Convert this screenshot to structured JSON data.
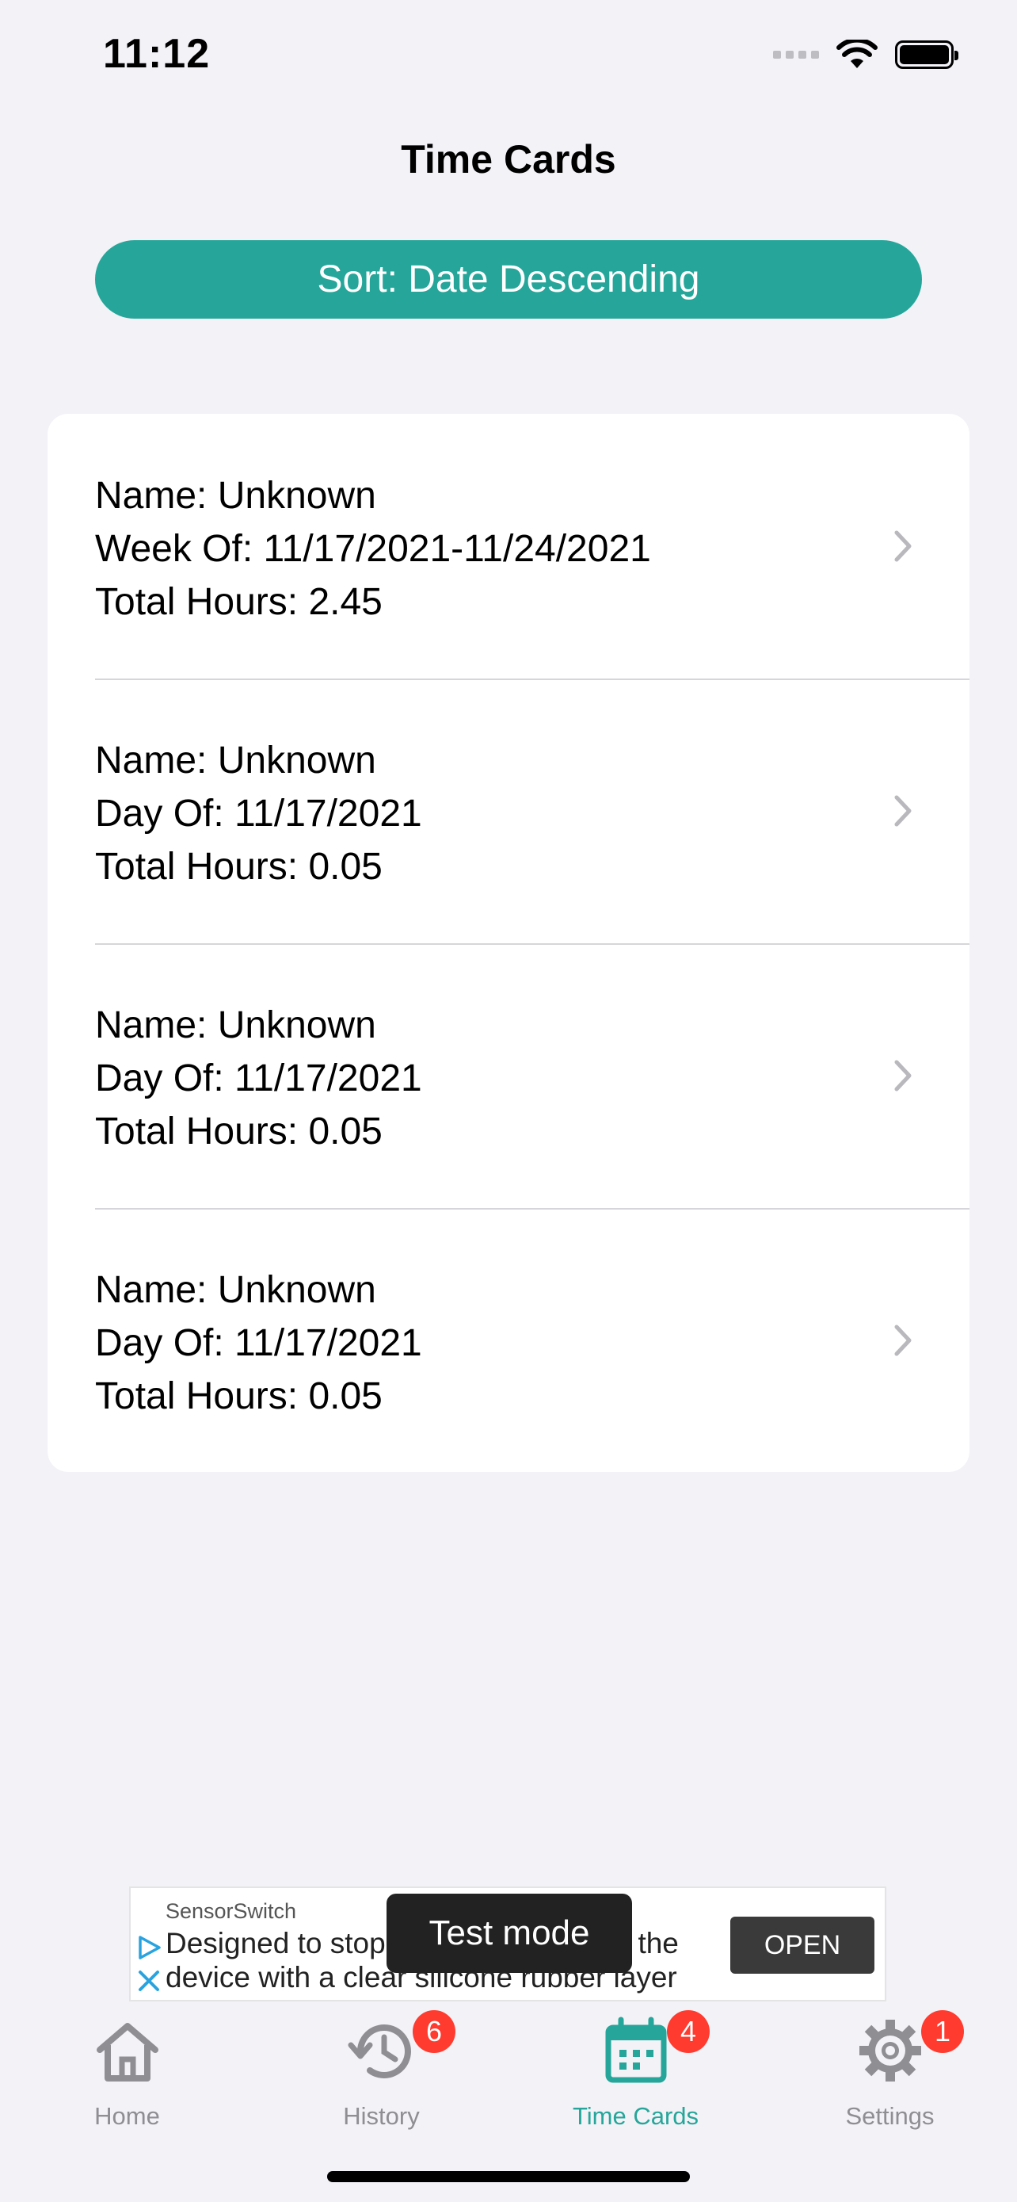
{
  "status_bar": {
    "time": "11:12"
  },
  "header": {
    "title": "Time Cards"
  },
  "sort_button": {
    "label": "Sort: Date Descending"
  },
  "time_cards": [
    {
      "name": "Name: Unknown",
      "period": "Week Of: 11/17/2021-11/24/2021",
      "hours": "Total Hours: 2.45"
    },
    {
      "name": "Name: Unknown",
      "period": "Day Of: 11/17/2021",
      "hours": "Total Hours: 0.05"
    },
    {
      "name": "Name: Unknown",
      "period": "Day Of: 11/17/2021",
      "hours": "Total Hours: 0.05"
    },
    {
      "name": "Name: Unknown",
      "period": "Day Of: 11/17/2021",
      "hours": "Total Hours: 0.05"
    }
  ],
  "ad": {
    "sponsor": "SensorSwitch",
    "line1": "Designed to stop dust from entering the",
    "line2": "device with a clear silicone rubber layer",
    "open_label": "OPEN",
    "test_mode": "Test mode"
  },
  "tabs": [
    {
      "label": "Home",
      "icon": "home-icon",
      "badge": ""
    },
    {
      "label": "History",
      "icon": "history-icon",
      "badge": "6"
    },
    {
      "label": "Time Cards",
      "icon": "calendar-icon",
      "badge": "4",
      "active": true
    },
    {
      "label": "Settings",
      "icon": "gear-icon",
      "badge": "1"
    }
  ],
  "colors": {
    "accent": "#26a69a",
    "badge": "#ff3b30",
    "background": "#f2f2f7",
    "inactive": "#8e8e93"
  }
}
